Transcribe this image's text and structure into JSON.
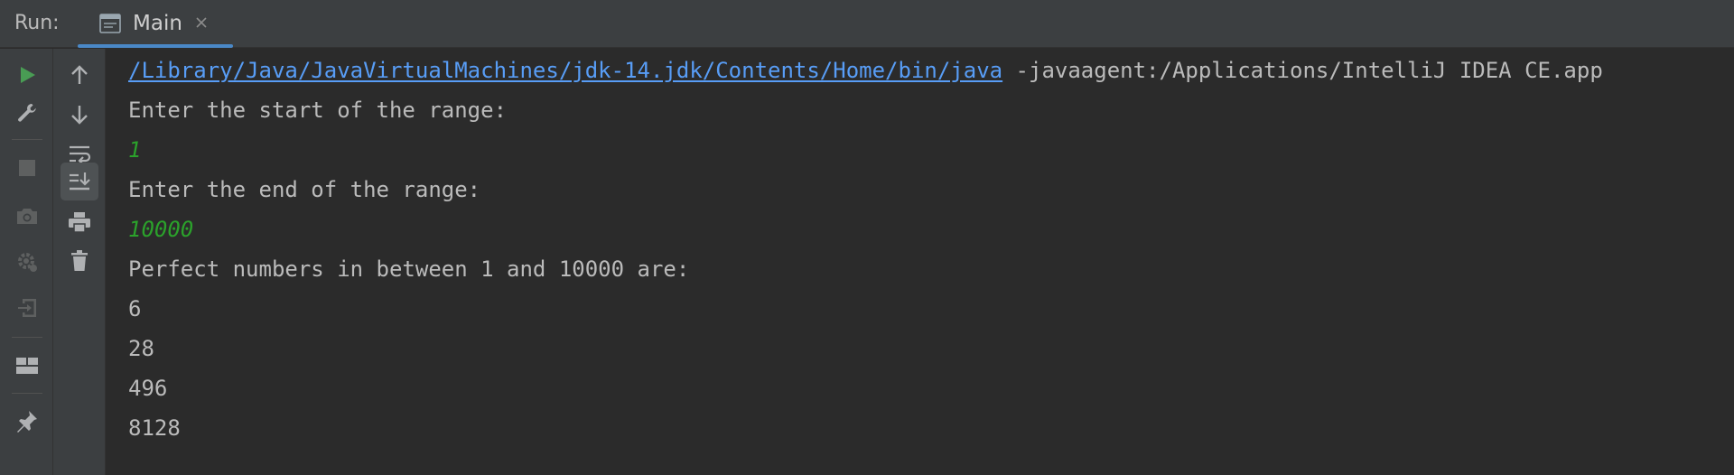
{
  "run_bar": {
    "label": "Run:",
    "tab": {
      "label": "Main",
      "icon": "window-icon",
      "close_icon": "close-icon"
    }
  },
  "toolbar_left": [
    {
      "name": "rerun-icon",
      "color": "#499c54"
    },
    {
      "name": "wrench-icon",
      "color": "#afb1b3"
    },
    {
      "name": "stop-icon",
      "color": "#5e6060"
    },
    {
      "name": "camera-icon",
      "color": "#5e6060"
    },
    {
      "name": "debug-gear-icon",
      "color": "#5e6060"
    },
    {
      "name": "exit-icon",
      "color": "#5e6060"
    },
    {
      "name": "layout-icon",
      "color": "#afb1b3"
    },
    {
      "name": "pin-icon",
      "color": "#afb1b3"
    }
  ],
  "toolbar_right": [
    {
      "name": "arrow-up-icon"
    },
    {
      "name": "arrow-down-icon"
    },
    {
      "name": "soft-wrap-icon"
    },
    {
      "name": "scroll-to-end-icon",
      "active": true
    },
    {
      "name": "print-icon"
    },
    {
      "name": "trash-icon"
    }
  ],
  "console": {
    "command": {
      "path": "/Library/Java/JavaVirtualMachines/jdk-14.jdk/Contents/Home/bin/java",
      "args": " -javaagent:/Applications/IntelliJ IDEA CE.app"
    },
    "lines": [
      {
        "text": "Enter the start of the range:",
        "kind": "output"
      },
      {
        "text": "1",
        "kind": "input"
      },
      {
        "text": "Enter the end of the range:",
        "kind": "output"
      },
      {
        "text": "10000",
        "kind": "input"
      },
      {
        "text": "Perfect numbers in between 1 and 10000 are:",
        "kind": "output"
      },
      {
        "text": "6",
        "kind": "output"
      },
      {
        "text": "28",
        "kind": "output"
      },
      {
        "text": "496",
        "kind": "output"
      },
      {
        "text": "8128",
        "kind": "output"
      }
    ]
  },
  "colors": {
    "background": "#2b2b2b",
    "toolbar": "#3c3f41",
    "text": "#bbbbbb",
    "link": "#589df6",
    "user_input": "#2ba12b",
    "tab_accent": "#4a88c7"
  }
}
